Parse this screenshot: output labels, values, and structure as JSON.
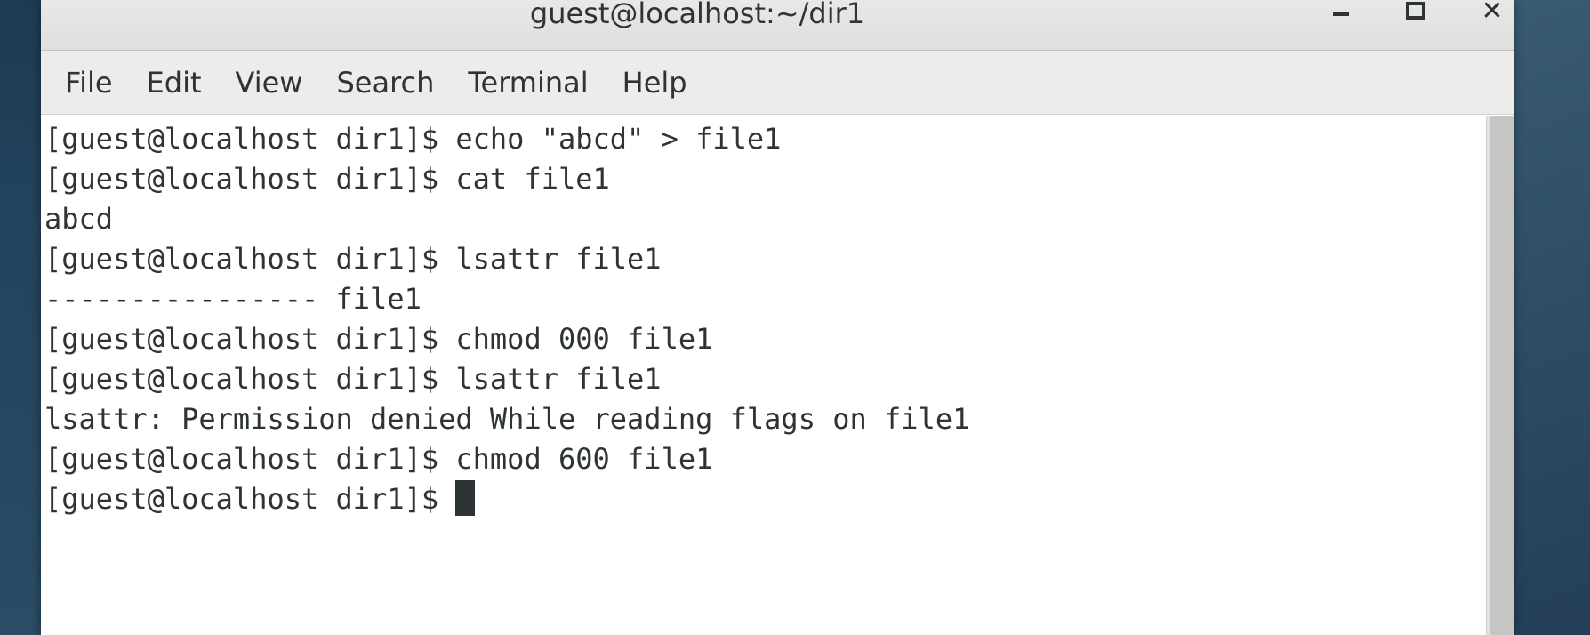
{
  "window": {
    "title": "guest@localhost:~/dir1",
    "controls": {
      "minimize_icon": "minimize-icon",
      "maximize_icon": "maximize-icon",
      "close_icon": "close-icon",
      "close_glyph": "✕"
    }
  },
  "menu": {
    "items": [
      "File",
      "Edit",
      "View",
      "Search",
      "Terminal",
      "Help"
    ]
  },
  "terminal": {
    "lines": [
      "[guest@localhost dir1]$ echo \"abcd\" > file1",
      "[guest@localhost dir1]$ cat file1",
      "abcd",
      "[guest@localhost dir1]$ lsattr file1",
      "---------------- file1",
      "[guest@localhost dir1]$ chmod 000 file1",
      "[guest@localhost dir1]$ lsattr file1",
      "lsattr: Permission denied While reading flags on file1",
      "[guest@localhost dir1]$ chmod 600 file1"
    ],
    "current_prompt": "[guest@localhost dir1]$ "
  },
  "colors": {
    "text": "#2e3436",
    "terminal_bg": "#ffffff",
    "titlebar_bg": "#e8e8e7",
    "desktop_bg": "#24445e"
  }
}
